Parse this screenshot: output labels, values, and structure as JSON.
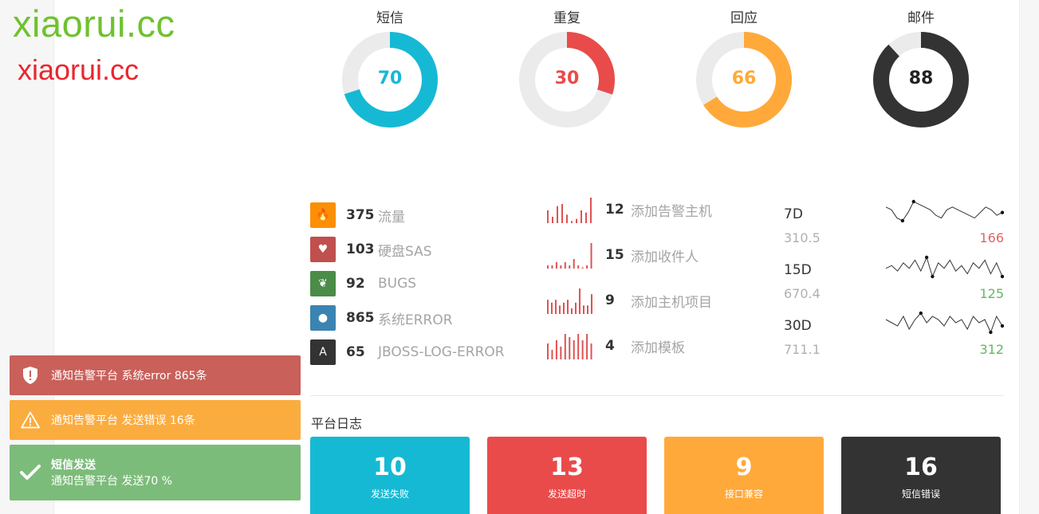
{
  "watermarks": [
    "xiaorui.cc",
    "xiaorui.cc"
  ],
  "donuts": [
    {
      "label": "短信",
      "value": "70",
      "percent": 70,
      "color": "#16b9d4"
    },
    {
      "label": "重复",
      "value": "30",
      "percent": 30,
      "color": "#e94b4b"
    },
    {
      "label": "回应",
      "value": "66",
      "percent": 66,
      "color": "#ffa93b"
    },
    {
      "label": "邮件",
      "value": "88",
      "percent": 88,
      "color": "#333333"
    }
  ],
  "stats": [
    {
      "value": "375",
      "label": "流量",
      "color": "#fc8f05",
      "icon": "fire-icon",
      "glyph": "🔥"
    },
    {
      "value": "103",
      "label": "硬盘SAS",
      "color": "#c0504d",
      "icon": "heart-icon",
      "glyph": "♥"
    },
    {
      "value": "92",
      "label": "BUGS",
      "color": "#4a8c48",
      "icon": "leaf-icon",
      "glyph": "❦"
    },
    {
      "value": "865",
      "label": "系统ERROR",
      "color": "#3b84b2",
      "icon": "drop-icon",
      "glyph": "●"
    },
    {
      "value": "65",
      "label": "JBOSS-LOG-ERROR",
      "color": "#333333",
      "icon": "road-icon",
      "glyph": "A"
    }
  ],
  "bar_sparks": [
    {
      "value": "12",
      "label": "添加告警主机",
      "bars": [
        6,
        3,
        8,
        9,
        4,
        1,
        2,
        6,
        5,
        12
      ]
    },
    {
      "value": "15",
      "label": "添加收件人",
      "bars": [
        1,
        1,
        2,
        1,
        2,
        1,
        3,
        1,
        0,
        1,
        8
      ]
    },
    {
      "value": "9",
      "label": "添加主机项目",
      "bars": [
        5,
        4,
        5,
        3,
        4,
        5,
        2,
        4,
        9,
        3,
        3,
        7
      ]
    },
    {
      "value": "4",
      "label": "添加模板",
      "bars": [
        5,
        3,
        6,
        4,
        8,
        7,
        6,
        8,
        6,
        8,
        5
      ]
    }
  ],
  "trends": [
    {
      "name": "7D",
      "sub": "310.5",
      "value": "166",
      "value_color": "#e06565",
      "points": [
        6,
        5,
        2,
        1,
        4,
        8,
        7,
        6,
        5,
        3,
        2,
        5,
        6,
        5,
        4,
        3,
        2,
        4,
        6,
        5,
        3,
        4
      ]
    },
    {
      "name": "15D",
      "sub": "670.4",
      "value": "125",
      "value_color": "#62b862",
      "points": [
        4,
        5,
        3,
        6,
        4,
        7,
        3,
        8,
        1,
        6,
        4,
        7,
        3,
        5,
        2,
        6,
        4,
        7,
        2,
        6,
        1
      ]
    },
    {
      "name": "30D",
      "sub": "711.1",
      "value": "312",
      "value_color": "#62b862",
      "points": [
        5,
        4,
        3,
        6,
        2,
        5,
        7,
        4,
        6,
        5,
        3,
        6,
        4,
        5,
        2,
        6,
        4,
        5,
        1,
        6,
        3
      ]
    }
  ],
  "section_title": "平台日志",
  "tiles": [
    {
      "value": "10",
      "label": "发送失败",
      "color": "#16b9d4"
    },
    {
      "value": "13",
      "label": "发送超时",
      "color": "#e94b4b"
    },
    {
      "value": "9",
      "label": "接口兼容",
      "color": "#ffa93b"
    },
    {
      "value": "16",
      "label": "短信错误",
      "color": "#333333"
    }
  ],
  "notifications": [
    {
      "text": "通知告警平台 系统error 865条",
      "color": "#c9605a",
      "icon": "shield-icon"
    },
    {
      "text": "通知告警平台 发送错误 16条",
      "color": "#fbac3f",
      "icon": "warning-icon"
    },
    {
      "title": "短信发送",
      "text": "通知告警平台 发送70 %",
      "color": "#7cbc7a",
      "icon": "check-icon"
    }
  ]
}
